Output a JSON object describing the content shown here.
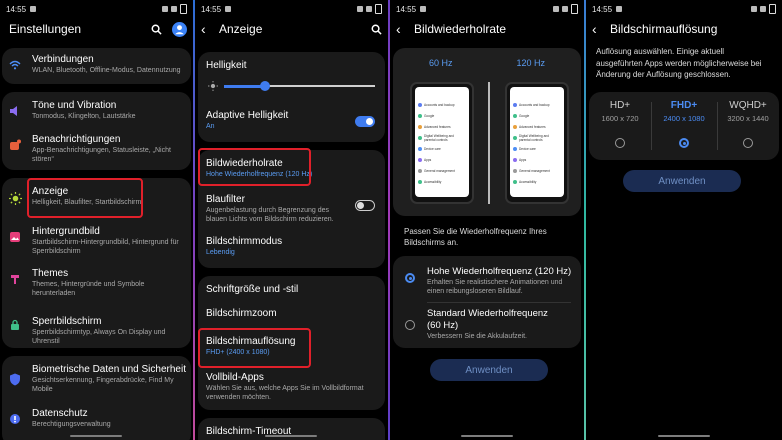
{
  "screens": [
    {
      "time": "14:55",
      "title": "Einstellungen",
      "items": [
        {
          "title": "Verbindungen",
          "sub": "WLAN, Bluetooth, Offline-Modus, Datennutzung",
          "icon": "wifi-icon",
          "color": "#4d8ef5"
        },
        {
          "title": "Töne und Vibration",
          "sub": "Tonmodus, Klingelton, Lautstärke",
          "icon": "volume-icon",
          "color": "#8a6cf0"
        },
        {
          "title": "Benachrichtigungen",
          "sub": "App-Benachrichtigungen, Statusleiste, „Nicht stören“",
          "icon": "notification-icon",
          "color": "#e8603c"
        },
        {
          "title": "Anzeige",
          "sub": "Helligkeit, Blaufilter, Startbildschirm",
          "icon": "brightness-icon",
          "color": "#b6d93b"
        },
        {
          "title": "Hintergrundbild",
          "sub": "Startbildschirm-Hintergrundbild, Hintergrund für Sperrbildschirm",
          "icon": "wallpaper-icon",
          "color": "#e63e7a"
        },
        {
          "title": "Themes",
          "sub": "Themes, Hintergründe und Symbole herunterladen",
          "icon": "themes-icon",
          "color": "#e0449c"
        },
        {
          "title": "Sperrbildschirm",
          "sub": "Sperrbildschirmtyp, Always On Display und Uhrenstil",
          "icon": "lock-screen-icon",
          "color": "#3fbf8a"
        },
        {
          "title": "Biometrische Daten und Sicherheit",
          "sub": "Gesichtserkennung, Fingerabdrücke, Find My Mobile",
          "icon": "shield-icon",
          "color": "#4d6cf0"
        },
        {
          "title": "Datenschutz",
          "sub": "Berechtigungsverwaltung",
          "icon": "privacy-icon",
          "color": "#4d6cf0"
        }
      ]
    },
    {
      "time": "14:55",
      "title": "Anzeige",
      "brightness_label": "Helligkeit",
      "brightness_level": 0.27,
      "items": [
        {
          "title": "Adaptive Helligkeit",
          "sub": "An"
        },
        {
          "title": "Bildwiederholrate",
          "sub": "Hohe Wiederholfrequenz (120 Hz)"
        },
        {
          "title": "Blaufilter",
          "sub": "Augenbelastung durch Begrenzung des blauen Lichts vom Bildschirm reduzieren."
        },
        {
          "title": "Bildschirmmodus",
          "sub": "Lebendig"
        },
        {
          "title": "Schriftgröße und -stil",
          "sub": ""
        },
        {
          "title": "Bildschirmzoom",
          "sub": ""
        },
        {
          "title": "Bildschirmauflösung",
          "sub": "FHD+ (2400 x 1080)"
        },
        {
          "title": "Vollbild-Apps",
          "sub": "Wählen Sie aus, welche Apps Sie im Vollbildformat verwenden möchten."
        },
        {
          "title": "Bildschirm-Timeout",
          "sub": ""
        }
      ]
    },
    {
      "time": "14:55",
      "title": "Bildwiederholrate",
      "label_60": "60 Hz",
      "label_120": "120 Hz",
      "preview_rows": [
        "Accounts and backup",
        "Google",
        "Advanced features",
        "Digital Wellbeing and parental controls",
        "Device care",
        "Apps",
        "General management",
        "Accessibility"
      ],
      "description": "Passen Sie die Wiederholfrequenz Ihres Bildschirms an.",
      "options": [
        {
          "title": "Hohe Wiederholfrequenz (120 Hz)",
          "sub": "Erhalten Sie realistischere Animationen und einen reibungsloseren Bildlauf."
        },
        {
          "title": "Standard Wiederholfrequenz (60 Hz)",
          "sub": "Verbessern Sie die Akkulaufzeit."
        }
      ],
      "apply": "Anwenden"
    },
    {
      "time": "14:55",
      "title": "Bildschirmauflösung",
      "description": "Auflösung auswählen. Einige aktuell ausgeführten Apps werden möglicherweise bei Änderung der Auflösung geschlossen.",
      "resolutions": [
        {
          "name": "HD+",
          "size": "1600 x 720"
        },
        {
          "name": "FHD+",
          "size": "2400 x 1080"
        },
        {
          "name": "WQHD+",
          "size": "3200 x 1440"
        }
      ],
      "apply": "Anwenden"
    }
  ]
}
